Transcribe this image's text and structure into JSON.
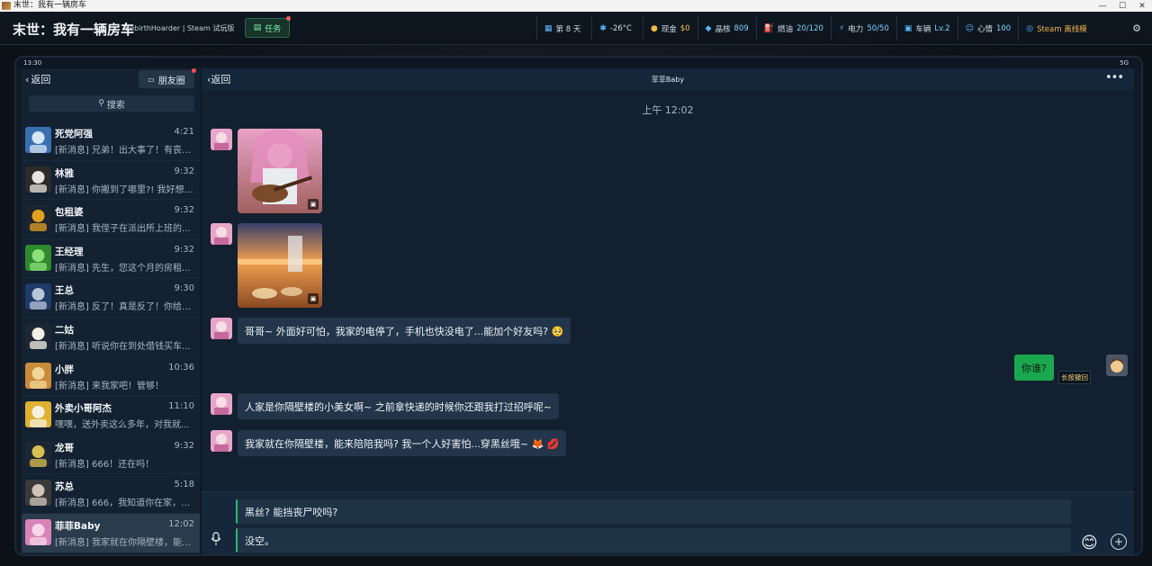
{
  "window": {
    "title": "末世：我有一辆房车"
  },
  "hud": {
    "game_title": "末世：我有一辆房车",
    "game_subtitle": "RebirthHoarder | Steam 试玩版",
    "task_label": "任务",
    "stats": [
      {
        "icon": "calendar-icon",
        "glyph": "▦",
        "label": "第 8 天",
        "value": ""
      },
      {
        "icon": "snowflake-icon",
        "glyph": "✱",
        "label": "-26°C",
        "value": ""
      },
      {
        "icon": "coin-icon",
        "glyph": "●",
        "label": "现金",
        "value": "$0",
        "kind": "money"
      },
      {
        "icon": "diamond-icon",
        "glyph": "◆",
        "label": "晶核",
        "value": "809"
      },
      {
        "icon": "fuel-icon",
        "glyph": "⛽",
        "label": "燃油",
        "value": "20/120"
      },
      {
        "icon": "power-icon",
        "glyph": "⚡",
        "label": "电力",
        "value": "50/50"
      },
      {
        "icon": "vehicle-icon",
        "glyph": "▣",
        "label": "车辆",
        "value": "Lv.2"
      },
      {
        "icon": "mood-icon",
        "glyph": "☺",
        "label": "心情",
        "value": "100"
      },
      {
        "icon": "steam-icon",
        "glyph": "◎",
        "label": "Steam 离线模",
        "value": "",
        "kind": "steam"
      }
    ]
  },
  "phone": {
    "status_time": "13:30",
    "status_signal": "5G",
    "sidebar": {
      "back_label": "返回",
      "moments_label": "朋友圈",
      "search_label": "搜索",
      "contacts": [
        {
          "name": "死党阿强",
          "time": "4:21",
          "preview": "[新消息] 兄弟！出大事了！有丧尸...",
          "av": [
            "#3a6fb0",
            "#d6e6f5"
          ]
        },
        {
          "name": "林雅",
          "time": "9:32",
          "preview": "[新消息] 你搬到了哪里?! 我好想你...",
          "av": [
            "#2b2b2b",
            "#e9e4df"
          ]
        },
        {
          "name": "包租婆",
          "time": "9:32",
          "preview": "[新消息] 我侄子在派出所上班的...",
          "av": [
            "#1c2430",
            "#e0a020"
          ]
        },
        {
          "name": "王经理",
          "time": "9:32",
          "preview": "[新消息] 先生，您这个月的房租...",
          "av": [
            "#2d8a2d",
            "#8fe07a"
          ]
        },
        {
          "name": "王总",
          "time": "9:30",
          "preview": "[新消息] 反了！真是反了！你给我...",
          "av": [
            "#1e3b6a",
            "#b9c6d8"
          ]
        },
        {
          "name": "二姑",
          "time": "",
          "preview": "[新消息] 听说你在到处借钱买车...",
          "av": [
            "#1d2733",
            "#f5f0e6"
          ]
        },
        {
          "name": "小胖",
          "time": "10:36",
          "preview": "[新消息] 来我家吧！管够！",
          "av": [
            "#c98a3a",
            "#f2d59a"
          ]
        },
        {
          "name": "外卖小哥阿杰",
          "time": "11:10",
          "preview": "嘿嘿，送外卖这么多年，对我就...",
          "av": [
            "#e0b030",
            "#f6f0e0"
          ]
        },
        {
          "name": "龙哥",
          "time": "9:32",
          "preview": "[新消息] 666！还在吗！",
          "av": [
            "#1d2733",
            "#d8c050"
          ]
        },
        {
          "name": "苏总",
          "time": "5:18",
          "preview": "[新消息] 666，我知道你在家，快...",
          "av": [
            "#3a3a3a",
            "#cfc5b8"
          ]
        },
        {
          "name": "菲菲Baby",
          "time": "12:02",
          "preview": "[新消息] 我家就在你隔壁楼，能来...",
          "av": [
            "#d884b8",
            "#f6d6e8"
          ],
          "active": true
        }
      ]
    },
    "chat": {
      "back_label": "返回",
      "title": "菲菲Baby",
      "more_glyph": "•••",
      "time_divider": "上午 12:02",
      "messages": {
        "m1": "哥哥~ 外面好可怕，我家的电停了，手机也快没电了...能加个好友吗? 🥺",
        "m2": "你谁?",
        "m2_hint": "长按撤回",
        "m3": "人家是你隔壁楼的小美女啊~ 之前拿快递的时候你还跟我打过招呼呢~",
        "m4": "我家就在你隔壁楼，能来陪陪我吗? 我一个人好害怕...穿黑丝哦~ 🦊 💋"
      },
      "options": [
        "黑丝? 能挡丧尸咬吗?",
        "没空。"
      ],
      "emoji_glyph": "😊",
      "plus_glyph": "+"
    }
  }
}
